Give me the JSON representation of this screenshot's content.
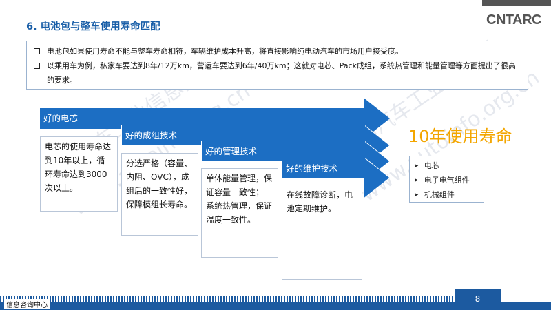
{
  "header": {
    "title": "6. 电池包与整车使用寿命匹配",
    "logo_text": "CNTARC"
  },
  "intro": {
    "bullets": [
      "电池包如果使用寿命不能与整车寿命相符，车辆维护成本升高，将直接影响纯电动汽车的市场用户接受度。",
      "以乘用车为例，私家车要达到8年/12万km，营运车要达到6年/40万km；这就对电芯、Pack成组，系统热管理和能量管理等方面提出了很高的要求。"
    ]
  },
  "stages": [
    {
      "label": "好的电芯",
      "body": "电芯的使用寿命达到10年以上，循环寿命达到3000次以上。"
    },
    {
      "label": "好的成组技术",
      "body": "分选严格（容量、内阻、OVC），成组后的一致性好，保障模组长寿命。"
    },
    {
      "label": "好的管理技术",
      "body": "单体能量管理，保证容量一致性；\n系统热管理，保证温度一致性。"
    },
    {
      "label": "好的维护技术",
      "body": "在线故障诊断，电池定期维护。"
    }
  ],
  "goal": {
    "title": "10年使用寿命",
    "components": [
      "电芯",
      "电子电气组件",
      "机械组件"
    ]
  },
  "watermark": {
    "text_a": "中国汽车工业信息网",
    "text_b": "www.autoinfo.org.cn"
  },
  "footer": {
    "left_text": "信息咨询中心",
    "page": "8"
  },
  "colors": {
    "accent_blue": "#1c6ec3",
    "title_blue": "#1a5fa8",
    "goal_orange": "#f3a600",
    "footer_blue": "#1c5aa0"
  }
}
